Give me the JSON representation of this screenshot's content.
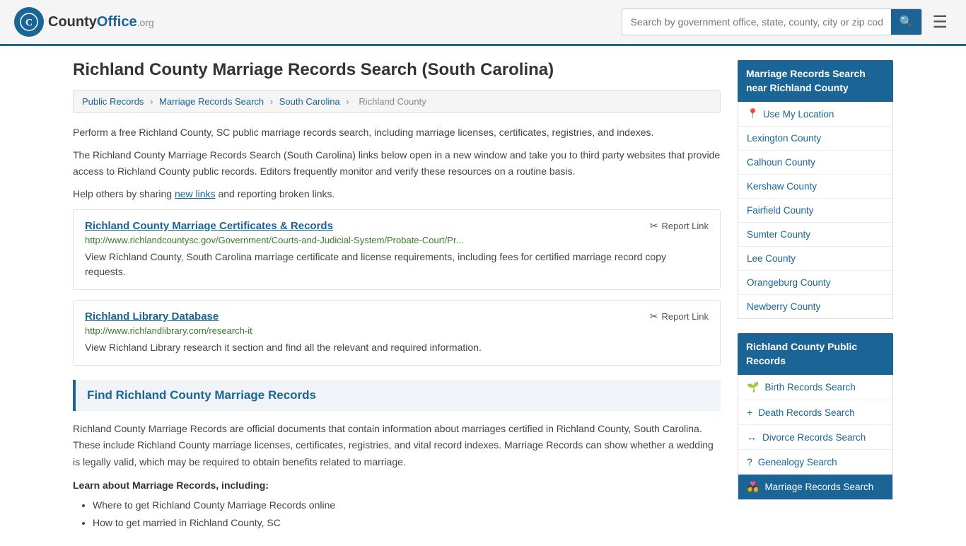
{
  "header": {
    "logo_text": "County",
    "logo_org": "Office",
    "logo_domain": ".org",
    "search_placeholder": "Search by government office, state, county, city or zip code",
    "search_icon_label": "🔍",
    "menu_icon_label": "☰"
  },
  "page": {
    "title": "Richland County Marriage Records Search (South Carolina)",
    "breadcrumb": {
      "items": [
        "Public Records",
        "Marriage Records Search",
        "South Carolina",
        "Richland County"
      ]
    },
    "intro1": "Perform a free Richland County, SC public marriage records search, including marriage licenses, certificates, registries, and indexes.",
    "intro2": "The Richland County Marriage Records Search (South Carolina) links below open in a new window and take you to third party websites that provide access to Richland County public records. Editors frequently monitor and verify these resources on a routine basis.",
    "intro3": "Help others by sharing",
    "new_links": "new links",
    "intro3b": "and reporting broken links."
  },
  "link_cards": [
    {
      "title": "Richland County Marriage Certificates & Records",
      "url": "http://www.richlandcountysc.gov/Government/Courts-and-Judicial-System/Probate-Court/Pr...",
      "description": "View Richland County, South Carolina marriage certificate and license requirements, including fees for certified marriage record copy requests.",
      "report_label": "Report Link"
    },
    {
      "title": "Richland Library Database",
      "url": "http://www.richlandlibrary.com/research-it",
      "description": "View Richland Library research it section and find all the relevant and required information.",
      "report_label": "Report Link"
    }
  ],
  "find_section": {
    "header": "Find Richland County Marriage Records",
    "text": "Richland County Marriage Records are official documents that contain information about marriages certified in Richland County, South Carolina. These include Richland County marriage licenses, certificates, registries, and vital record indexes. Marriage Records can show whether a wedding is legally valid, which may be required to obtain benefits related to marriage.",
    "subheader": "Learn about Marriage Records, including:",
    "list_items": [
      "Where to get Richland County Marriage Records online",
      "How to get married in Richland County, SC"
    ]
  },
  "sidebar": {
    "nearby_title": "Marriage Records Search near Richland County",
    "nearby_items": [
      {
        "label": "Use My Location",
        "icon": "📍"
      },
      {
        "label": "Lexington County",
        "icon": ""
      },
      {
        "label": "Calhoun County",
        "icon": ""
      },
      {
        "label": "Kershaw County",
        "icon": ""
      },
      {
        "label": "Fairfield County",
        "icon": ""
      },
      {
        "label": "Sumter County",
        "icon": ""
      },
      {
        "label": "Lee County",
        "icon": ""
      },
      {
        "label": "Orangeburg County",
        "icon": ""
      },
      {
        "label": "Newberry County",
        "icon": ""
      }
    ],
    "public_records_title": "Richland County Public Records",
    "public_records_items": [
      {
        "label": "Birth Records Search",
        "icon": "🌱",
        "active": false
      },
      {
        "label": "Death Records Search",
        "icon": "+",
        "active": false
      },
      {
        "label": "Divorce Records Search",
        "icon": "↔",
        "active": false
      },
      {
        "label": "Genealogy Search",
        "icon": "?",
        "active": false
      },
      {
        "label": "Marriage Records Search",
        "icon": "💑",
        "active": true
      }
    ]
  }
}
